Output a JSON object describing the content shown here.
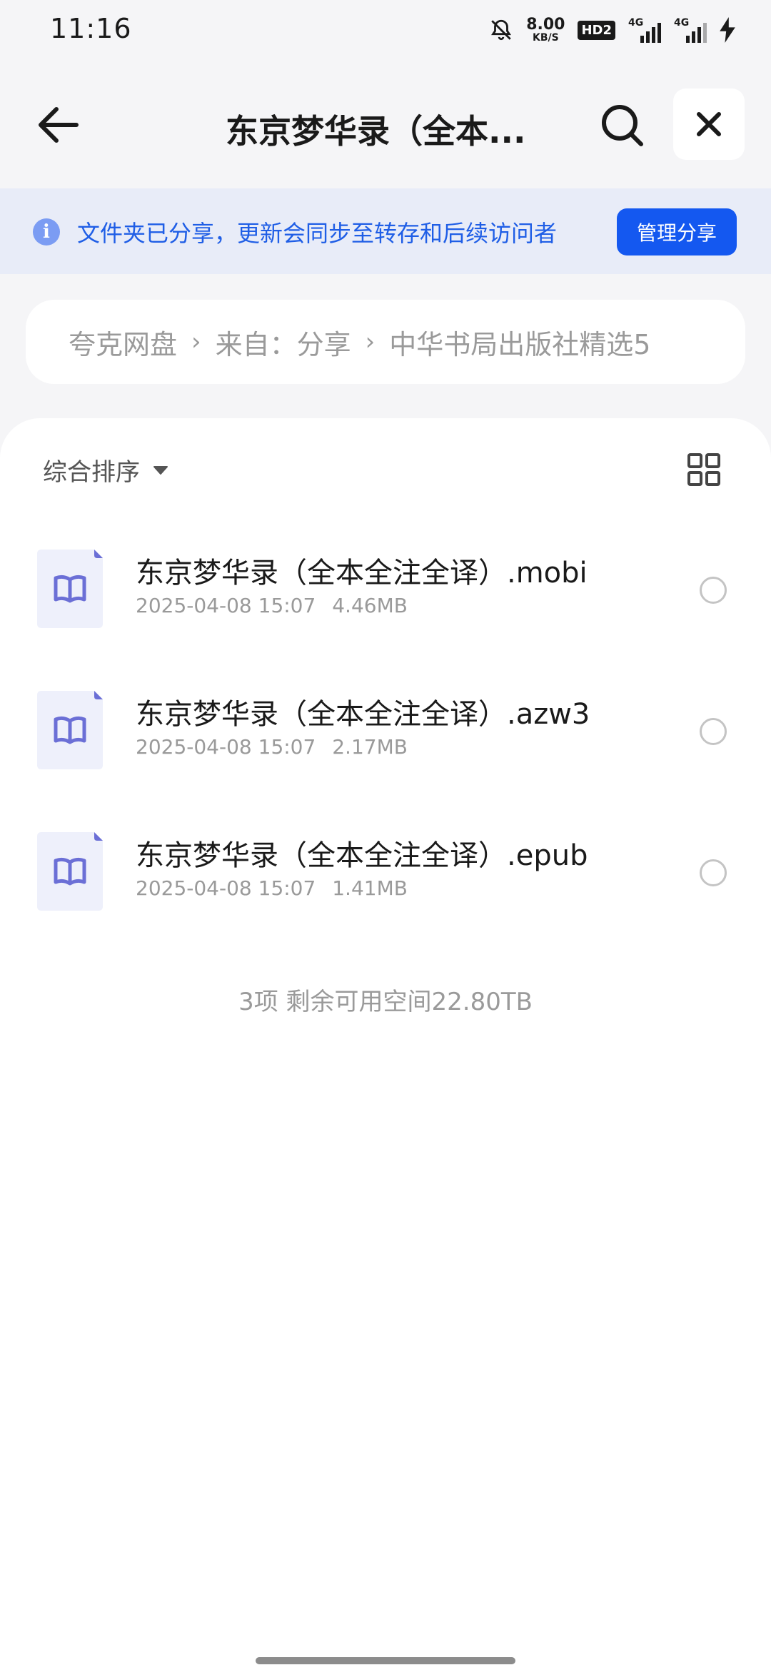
{
  "status_bar": {
    "time": "11:16",
    "net_speed_value": "8.00",
    "net_speed_unit": "KB/S",
    "hd_badge": "HD2",
    "signal1_label": "4G",
    "signal2_label": "4G"
  },
  "header": {
    "title": "东京梦华录（全本...",
    "back_icon": "arrow-left-icon",
    "search_icon": "search-icon",
    "close_icon": "close-icon"
  },
  "share_banner": {
    "icon": "info-icon",
    "icon_glyph": "i",
    "text": "文件夹已分享，更新会同步至转存和后续访问者",
    "manage_label": "管理分享",
    "text_color": "#1f5ee6",
    "button_color": "#1458f0"
  },
  "breadcrumb": {
    "items": [
      "夸克网盘",
      "来自：分享",
      "中华书局出版社精选5"
    ],
    "separator": "›"
  },
  "toolbar": {
    "sort_label": "综合排序",
    "grid_icon": "grid-view-icon"
  },
  "files": [
    {
      "name": "东京梦华录（全本全注全译）.mobi",
      "date": "2025-04-08 15:07",
      "size": "4.46MB",
      "selected": false
    },
    {
      "name": "东京梦华录（全本全注全译）.azw3",
      "date": "2025-04-08 15:07",
      "size": "2.17MB",
      "selected": false
    },
    {
      "name": "东京梦华录（全本全注全译）.epub",
      "date": "2025-04-08 15:07",
      "size": "1.41MB",
      "selected": false
    }
  ],
  "summary": "3项 剩余可用空间22.80TB",
  "colors": {
    "accent": "#1458f0",
    "book_icon": "#6b6fd6"
  }
}
